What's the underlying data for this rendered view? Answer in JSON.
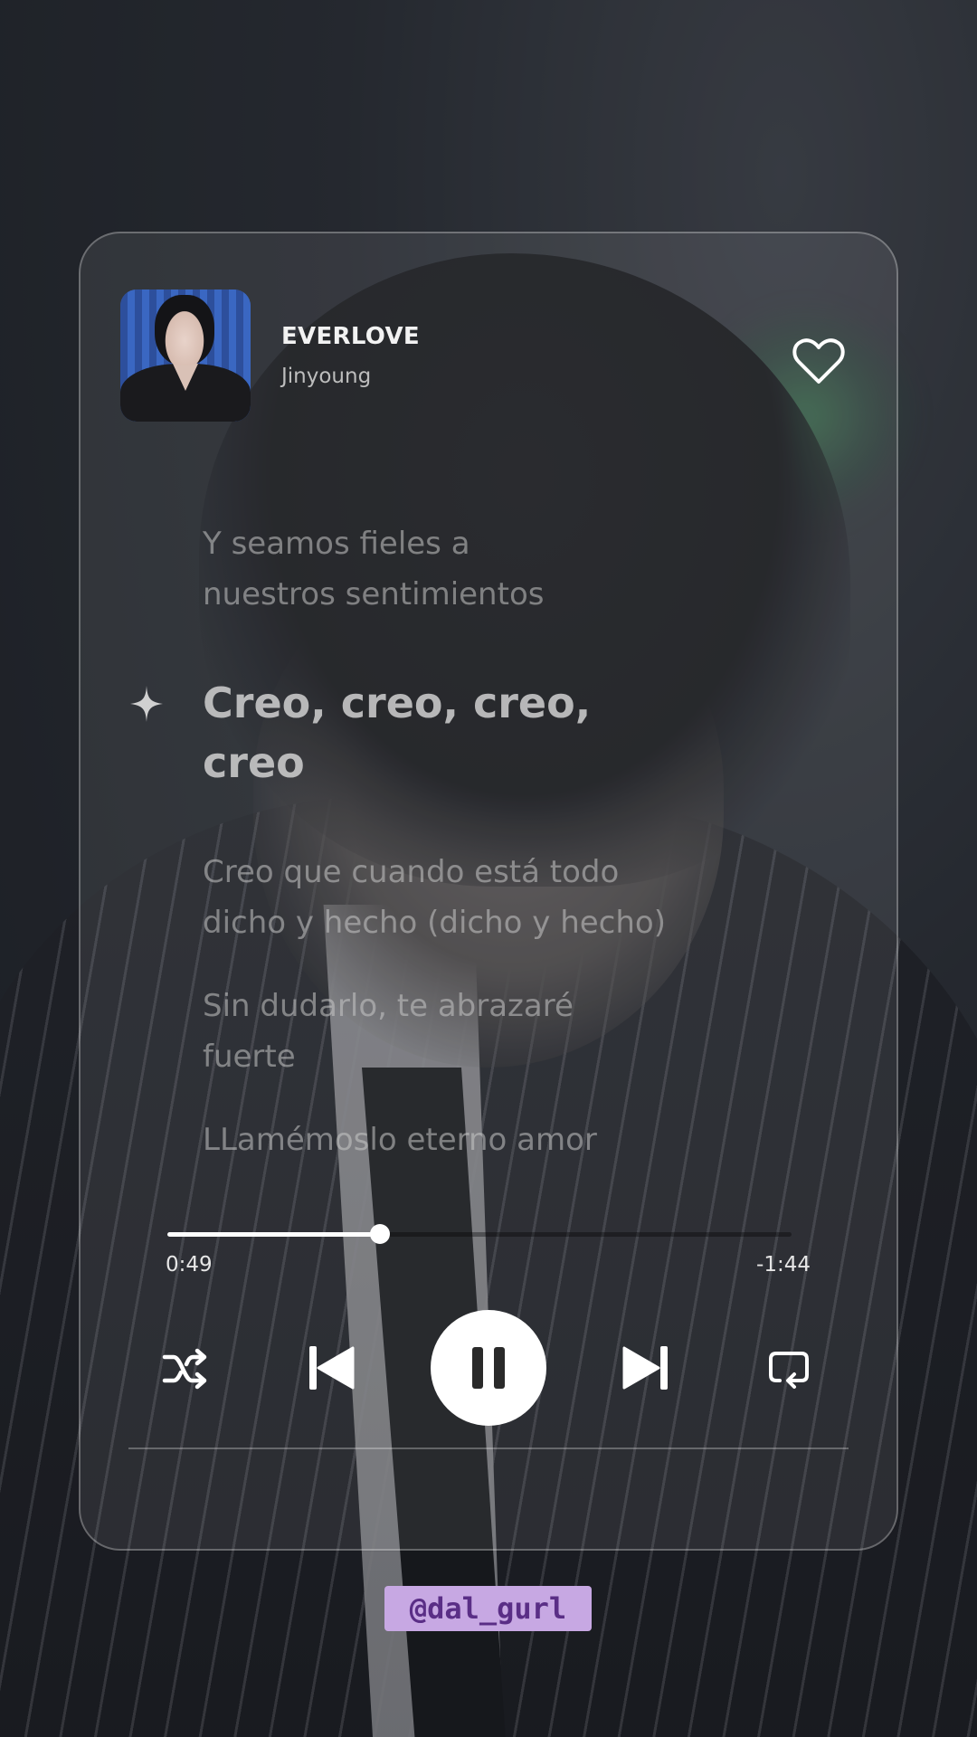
{
  "now_playing": {
    "title": "EVERLOVE",
    "artist": "Jinyoung",
    "liked": false
  },
  "lyrics": [
    {
      "text": "Y seamos fieles a\nnuestros sentimientos",
      "current": false
    },
    {
      "text": "Creo, creo, creo,\ncreo",
      "current": true
    },
    {
      "text": "Creo que cuando está todo\ndicho y hecho (dicho y hecho)",
      "current": false
    },
    {
      "text": "Sin dudarlo, te abrazaré\nfuerte",
      "current": false
    },
    {
      "text": "LLamémoslo eterno amor",
      "current": false
    }
  ],
  "playback": {
    "elapsed": "0:49",
    "remaining": "-1:44",
    "progress": 0.34,
    "state": "playing"
  },
  "controls": {
    "shuffle_icon": "shuffle-icon",
    "previous_icon": "skip-previous-icon",
    "play_pause_icon": "pause-icon",
    "next_icon": "skip-next-icon",
    "repeat_icon": "repeat-icon"
  },
  "watermark": "@dal_gurl",
  "colors": {
    "accent": "#ffffff",
    "watermark_bg": "#c7a8e3",
    "watermark_text": "#5a2e86"
  }
}
